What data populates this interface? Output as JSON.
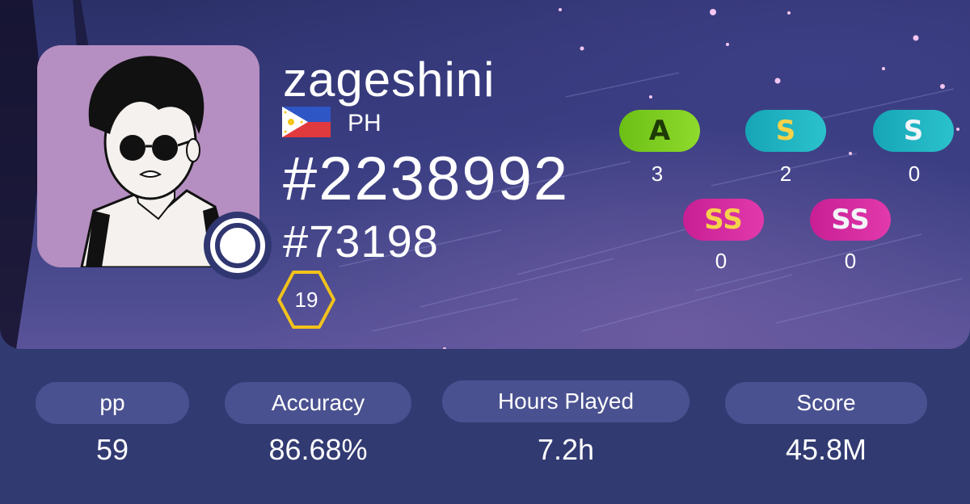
{
  "profile": {
    "username": "zageshini",
    "country_code": "PH",
    "global_rank": "#2238992",
    "country_rank": "#73198",
    "level": "19"
  },
  "grades": [
    {
      "grade": "A",
      "count": "3",
      "color": "#7acb1c"
    },
    {
      "grade": "S",
      "count": "2",
      "color": "#1fb2c0"
    },
    {
      "grade": "S",
      "count": "0",
      "color": "#1fb2c0"
    },
    {
      "grade": "SS",
      "count": "0",
      "color": "#d62a9f"
    },
    {
      "grade": "SS",
      "count": "0",
      "color": "#d62a9f"
    }
  ],
  "stats": [
    {
      "label": "pp",
      "value": "59"
    },
    {
      "label": "Accuracy",
      "value": "86.68%"
    },
    {
      "label": "Hours Played",
      "value": "7.2h"
    },
    {
      "label": "Score",
      "value": "45.8M"
    }
  ],
  "colors": {
    "background": "#323a72",
    "pill": "#4a5190",
    "level_ring": "#f2c21b",
    "avatar_bg": "#b58fc1"
  }
}
